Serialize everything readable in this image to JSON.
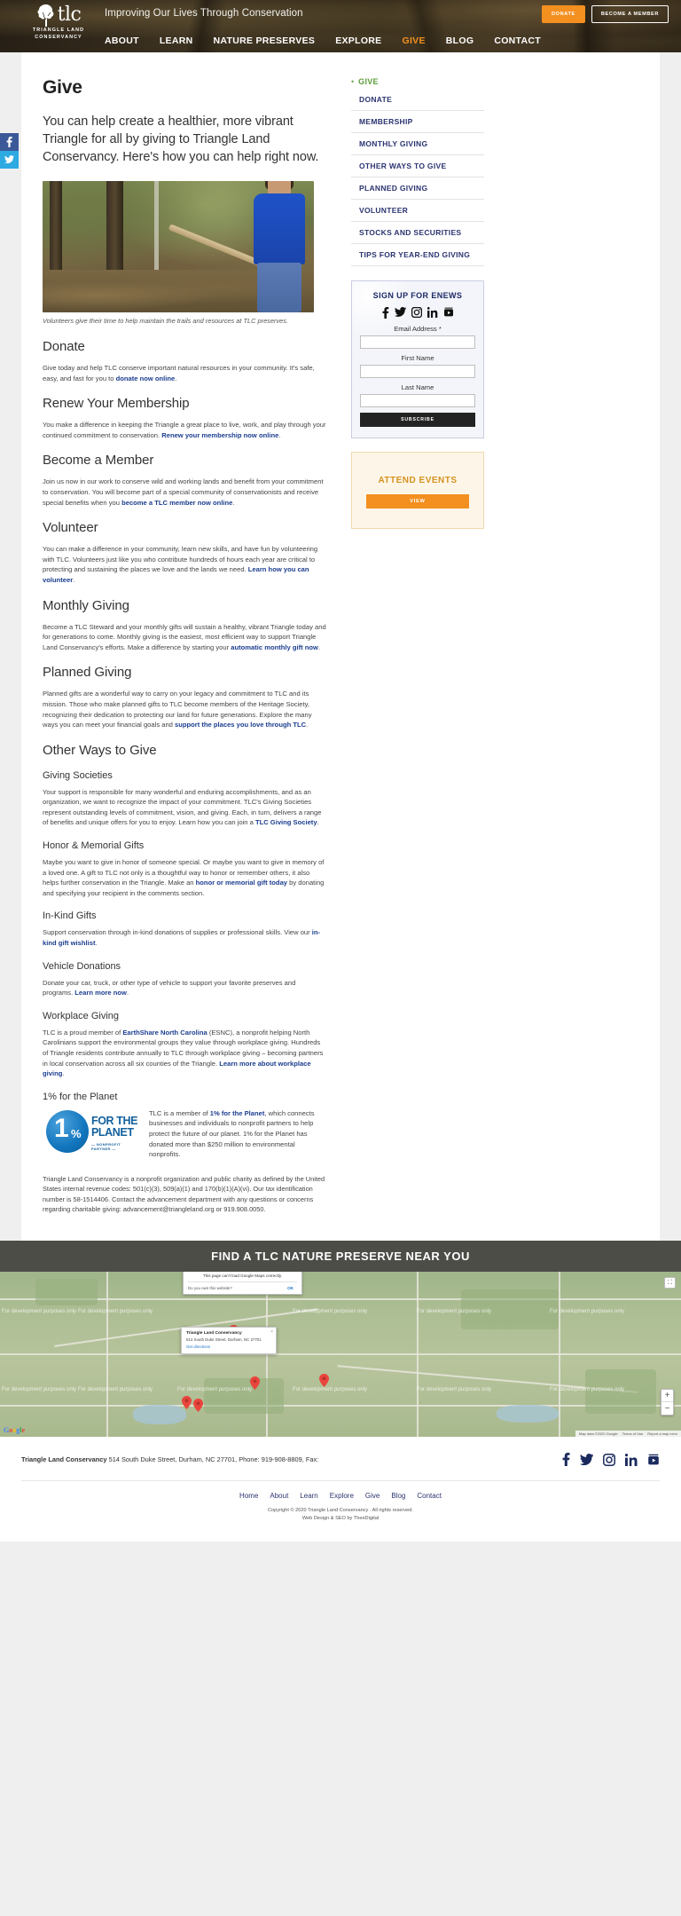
{
  "header": {
    "logo_word": "tlc",
    "logo_sub_line1": "TRIANGLE LAND",
    "logo_sub_line2": "CONSERVANCY",
    "tagline": "Improving Our Lives Through Conservation",
    "donate_button": "DONATE",
    "member_button": "BECOME A MEMBER",
    "nav": [
      {
        "label": "ABOUT",
        "active": false
      },
      {
        "label": "LEARN",
        "active": false
      },
      {
        "label": "NATURE PRESERVES",
        "active": false
      },
      {
        "label": "EXPLORE",
        "active": false
      },
      {
        "label": "GIVE",
        "active": true
      },
      {
        "label": "BLOG",
        "active": false
      },
      {
        "label": "CONTACT",
        "active": false
      }
    ]
  },
  "social_rail": [
    {
      "name": "facebook",
      "glyph": "f"
    },
    {
      "name": "twitter",
      "glyph": "t"
    }
  ],
  "main": {
    "title": "Give",
    "lede": "You can help create a healthier, more vibrant Triangle for all by giving to Triangle Land Conservancy. Here's how you can help right now.",
    "photo_caption": "Volunteers give their time to help maintain the trails and resources at TLC preserves.",
    "sections": [
      {
        "heading": "Donate",
        "level": "h2",
        "body_pre": "Give today and help TLC conserve important natural resources in your community. It's safe, easy, and fast for you to ",
        "link": "donate now online",
        "body_post": "."
      },
      {
        "heading": "Renew Your Membership",
        "level": "h2",
        "body_pre": "You make a difference in keeping the Triangle a great place to live, work, and play through your continued commitment to conservation. ",
        "link": "Renew your membership now online",
        "body_post": "."
      },
      {
        "heading": "Become a Member",
        "level": "h2",
        "body_pre": "Join us now in our work to conserve wild and working lands and benefit from your commitment to conservation. You will become part of a special community of conservationists and receive special benefits when you ",
        "link": "become a TLC member now online",
        "body_post": "."
      },
      {
        "heading": "Volunteer",
        "level": "h2",
        "body_pre": "You can make a difference in your community, learn new skills, and have fun by volunteering with TLC. Volunteers just like you who contribute hundreds of hours each year are critical to protecting and sustaining the places we love and the lands we need. ",
        "link": "Learn how you can volunteer",
        "body_post": "."
      },
      {
        "heading": "Monthly Giving",
        "level": "h2",
        "body_pre": "Become a TLC Steward and your monthly gifts will sustain a healthy, vibrant Triangle today and for generations to come. Monthly giving is the easiest, most efficient way to support Triangle Land Conservancy's efforts. Make a difference by starting your ",
        "link": "automatic monthly gift now",
        "body_post": "."
      },
      {
        "heading": "Planned Giving",
        "level": "h2",
        "body_pre": "Planned gifts are a wonderful way to carry on your legacy and commitment to TLC and its mission. Those who make planned gifts to TLC become members of the Heritage Society, recognizing their dedication to protecting our land for future generations. Explore the many ways you can meet your financial goals and ",
        "link": "support the places you love through TLC",
        "body_post": "."
      },
      {
        "heading": "Other Ways to Give",
        "level": "h2",
        "body_pre": "",
        "link": "",
        "body_post": ""
      },
      {
        "heading": "Giving Societies",
        "level": "h3",
        "body_pre": "Your support is responsible for many wonderful and enduring accomplishments, and as an organization, we want to recognize the impact of your commitment. TLC's Giving Societies represent outstanding levels of commitment, vision, and giving. Each, in turn, delivers a range of benefits and unique offers for you to enjoy. Learn how you can join a ",
        "link": "TLC Giving Society",
        "body_post": "."
      },
      {
        "heading": "Honor & Memorial Gifts",
        "level": "h3",
        "body_pre": "Maybe you want to give in honor of someone special. Or maybe you want to give in memory of a loved one. A gift to TLC not only is a thoughtful way to honor or remember others, it also helps further conservation in the Triangle. Make an ",
        "link": "honor or memorial gift today",
        "body_post": " by donating and specifying your recipient in the comments section."
      },
      {
        "heading": "In-Kind Gifts",
        "level": "h3",
        "body_pre": "Support conservation through in-kind donations of supplies or professional skills. View our ",
        "link": "in-kind gift wishlist",
        "body_post": "."
      },
      {
        "heading": "Vehicle Donations",
        "level": "h3",
        "body_pre": "Donate your car, truck, or other type of vehicle to support your favorite preserves and programs. ",
        "link": "Learn more now",
        "body_post": "."
      },
      {
        "heading": "Workplace Giving",
        "level": "h3",
        "body_pre": "TLC is a proud member of ",
        "link": "EarthShare North Carolina",
        "body_post": " (ESNC), a nonprofit helping North Carolinians support the environmental groups they value through workplace giving. Hundreds of Triangle residents contribute annually to TLC through workplace giving – becoming partners in local conservation across all six counties of the Triangle. ",
        "link2": "Learn more about workplace giving",
        "body_post2": "."
      }
    ],
    "planet": {
      "heading": "1% for the Planet",
      "logo_one": "1",
      "logo_pct": "%",
      "logo_line1": "FOR THE",
      "logo_line2": "PLANET",
      "logo_tag": "— NONPROFIT PARTNER —",
      "body_pre": "TLC is a member of ",
      "link": "1% for the Planet",
      "body_post": ", which connects businesses and individuals to nonprofit partners to help protect the future of our planet. 1% for the Planet has donated more than $250 million to environmental nonprofits."
    },
    "legal": "Triangle Land Conservancy is a nonprofit organization and public charity as defined by the United States internal revenue codes: 501(c)(3), 509(a)(1) and 170(b)(1)(A)(vi). Our tax identification number is 58-1514406. Contact the advancement department with any questions or concerns regarding charitable giving: advancement@triangleland.org or 919.908.0050."
  },
  "sidebar": {
    "current_label": "GIVE",
    "items": [
      {
        "label": "DONATE"
      },
      {
        "label": "MEMBERSHIP"
      },
      {
        "label": "MONTHLY GIVING"
      },
      {
        "label": "OTHER WAYS TO GIVE"
      },
      {
        "label": "PLANNED GIVING"
      },
      {
        "label": "VOLUNTEER"
      },
      {
        "label": "STOCKS AND SECURITIES"
      },
      {
        "label": "TIPS FOR YEAR-END GIVING"
      }
    ],
    "enews": {
      "title": "SIGN UP FOR ENEWS",
      "email_label": "Email Address *",
      "email_value": "",
      "first_label": "First Name",
      "first_value": "",
      "last_label": "Last Name",
      "last_value": "",
      "subscribe": "SUBSCRIBE",
      "socials": [
        "facebook-icon",
        "twitter-icon",
        "instagram-icon",
        "linkedin-icon",
        "youtube-icon"
      ]
    },
    "events": {
      "title": "ATTEND EVENTS",
      "button": "VIEW"
    }
  },
  "map": {
    "band_title": "FIND A TLC NATURE PRESERVE NEAR YOU",
    "gmaps_warning": "This page can't load Google Maps correctly.",
    "gmaps_question": "Do you own this website?",
    "gmaps_ok": "OK",
    "bubble_title": "Triangle Land Conservancy",
    "bubble_address": "514 South Duke Street, Durham, NC 27701",
    "bubble_directions": "Get directions",
    "bubble_close": "×",
    "zoom_in": "+",
    "zoom_out": "−",
    "attribution": [
      "Map data ©2020 Google",
      "Terms of Use",
      "Report a map error"
    ],
    "watermark": "For development purposes only",
    "logo": "Google"
  },
  "footer": {
    "org": "Triangle Land Conservancy",
    "address": " 514 South Duke Street, Durham, NC 27701, Phone: 919-908-8809, Fax:",
    "socials": [
      "facebook-icon",
      "twitter-icon",
      "instagram-icon",
      "linkedin-icon",
      "youtube-icon"
    ],
    "nav": [
      "Home",
      "About",
      "Learn",
      "Explore",
      "Give",
      "Blog",
      "Contact"
    ],
    "copyright_line1": "Copyright © 2020 Triangle Land Conservancy . All rights reserved.",
    "copyright_line2": "Web Design & SEO by TheeDigital"
  },
  "colors": {
    "brand_orange": "#f39020",
    "brand_green": "#5a9c39",
    "nav_blue": "#2b3470",
    "header_dark": "#2c2419"
  }
}
